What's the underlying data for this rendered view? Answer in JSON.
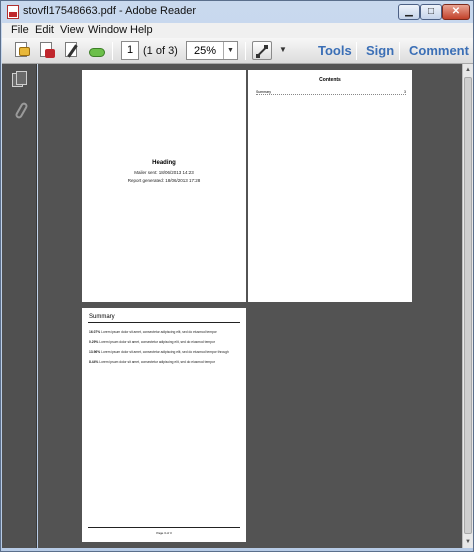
{
  "window": {
    "title": "stovfl17548663.pdf - Adobe Reader"
  },
  "menu": [
    "File",
    "Edit",
    "View",
    "Window",
    "Help"
  ],
  "toolbar": {
    "page_number": "1",
    "page_count": "(1 of 3)",
    "zoom": "25%",
    "tools_label": "Tools",
    "sign_label": "Sign",
    "comment_label": "Comment",
    "icons": [
      "open-icon",
      "create-pdf-icon",
      "edit-icon",
      "cloud-upload-icon",
      "fit-page-icon"
    ]
  },
  "left_panel": {
    "icons": [
      "page-thumbnails-icon",
      "attachments-icon"
    ]
  },
  "pages": {
    "page1": {
      "heading": "Heading",
      "mailer_sent": "Mailer sent: 18/06/2013 14:23",
      "report_generated": "Report generated: 18/06/2013 17:28"
    },
    "page2": {
      "toc_title": "Contents",
      "entry_label": "Summary",
      "entry_page": "3"
    },
    "page3": {
      "summary_title": "Summary",
      "lines": [
        {
          "pct": "16.07%",
          "text": "Lorem ipsum dolor sit amet, consectetur adipiscing elit, sed do eiusmod tempor"
        },
        {
          "pct": "0.29%",
          "text": "Lorem ipsum dolor sit amet, consectetur adipiscing elit, sed do eiusmod tempor"
        },
        {
          "pct": "13.96%",
          "text": "Lorem ipsum dolor sit amet, consectetur adipiscing elit, sed do eiusmod tempor through"
        },
        {
          "pct": "8.44%",
          "text": "Lorem ipsum dolor sit amet, consectetur adipiscing elit, sed do eiusmod tempor"
        }
      ],
      "footer": "Page 3 of 3"
    }
  }
}
